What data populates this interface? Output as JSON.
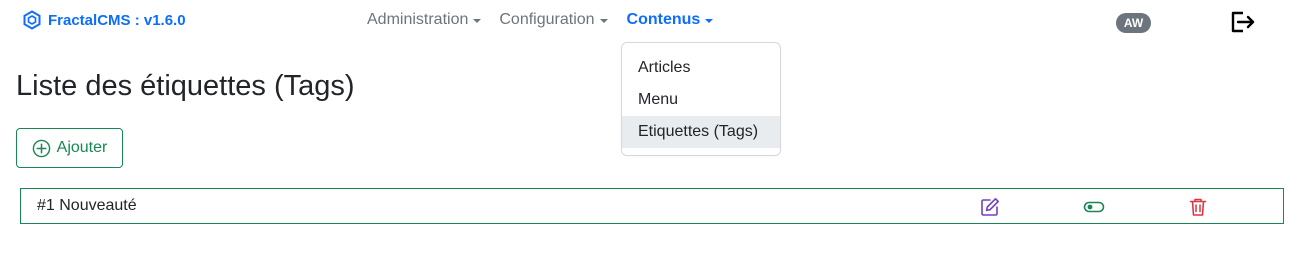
{
  "brand": {
    "name": "FractalCMS : v1.6.0",
    "icon": "fractal-logo-icon"
  },
  "nav": {
    "items": [
      {
        "label": "Administration",
        "active": false
      },
      {
        "label": "Configuration",
        "active": false
      },
      {
        "label": "Contenus",
        "active": true
      }
    ]
  },
  "user": {
    "initials": "AW"
  },
  "logout": {
    "icon": "logout-icon"
  },
  "dropdown": {
    "items": [
      {
        "label": "Articles"
      },
      {
        "label": "Menu"
      },
      {
        "label": "Etiquettes (Tags)",
        "active": true
      }
    ]
  },
  "page": {
    "title": "Liste des étiquettes (Tags)",
    "add_label": "Ajouter"
  },
  "tags": [
    {
      "label": "#1 Nouveauté",
      "actions": [
        "edit-icon",
        "toggle-icon",
        "delete-icon"
      ]
    }
  ],
  "colors": {
    "primary": "#0d6efd",
    "success": "#198754",
    "danger": "#dc3545",
    "edit": "#6f42c1",
    "muted": "#6c757d"
  }
}
